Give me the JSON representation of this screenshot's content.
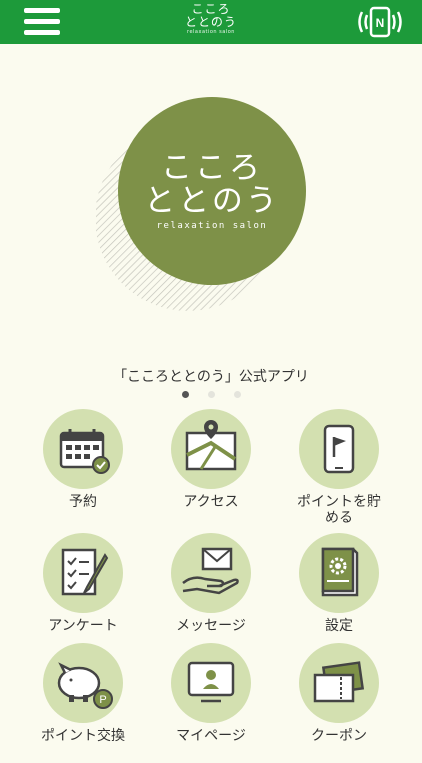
{
  "header": {
    "logo_line1": "こころ",
    "logo_line2": "ととのう",
    "logo_line3": "relaxation salon"
  },
  "hero": {
    "line1": "こころ",
    "line2": "ととのう",
    "line3": "relaxation salon",
    "caption": "「こころととのう」公式アプリ"
  },
  "menu": [
    {
      "label": "予約"
    },
    {
      "label": "アクセス"
    },
    {
      "label": "ポイントを貯\nめる"
    },
    {
      "label": "アンケート"
    },
    {
      "label": "メッセージ"
    },
    {
      "label": "設定"
    },
    {
      "label": "ポイント交換"
    },
    {
      "label": "マイページ"
    },
    {
      "label": "クーポン"
    }
  ],
  "colors": {
    "header": "#1d9a3a",
    "accent": "#7e9148",
    "tile_bg": "#d3e0b0",
    "page_bg": "#fbfbef"
  }
}
